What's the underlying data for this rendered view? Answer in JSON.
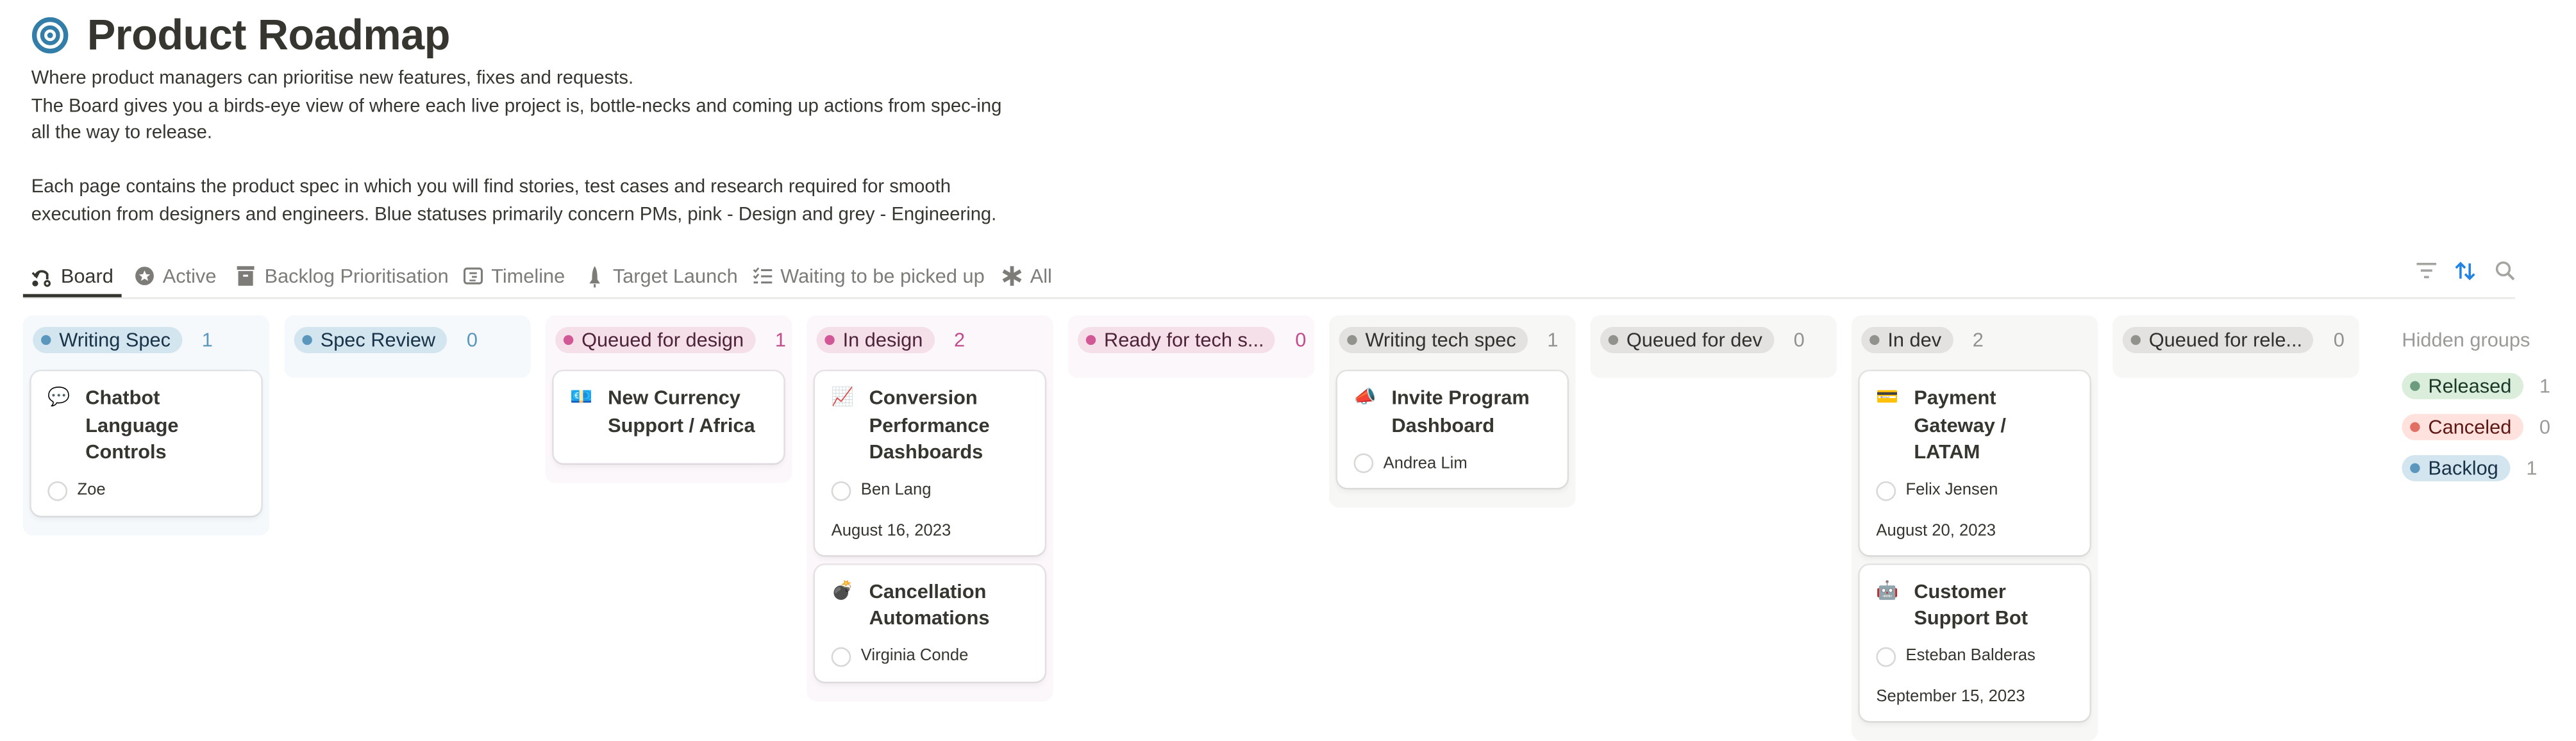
{
  "page": {
    "icon": "target-icon",
    "title": "Product Roadmap",
    "description": [
      "Where product managers can prioritise new features, fixes and requests.",
      "The Board gives you a birds-eye view of where each live project is, bottle-necks and coming up actions from spec-ing",
      "all the way to release.",
      "",
      "Each page contains the product spec in which you will find stories, test cases and research required for smooth",
      "execution from designers and engineers. Blue statuses primarily concern PMs, pink - Design and grey - Engineering."
    ]
  },
  "tabs": [
    {
      "label": "Board",
      "icon": "board-icon",
      "active": true
    },
    {
      "label": "Active",
      "icon": "star-circle-icon",
      "active": false
    },
    {
      "label": "Backlog Prioritisation",
      "icon": "archive-box-icon",
      "active": false
    },
    {
      "label": "Timeline",
      "icon": "timeline-icon",
      "active": false
    },
    {
      "label": "Target Launch",
      "icon": "rocket-icon",
      "active": false
    },
    {
      "label": "Waiting to be picked up",
      "icon": "checklist-icon",
      "active": false
    },
    {
      "label": "All",
      "icon": "asterisk-icon",
      "active": false
    }
  ],
  "toolbar": {
    "filter_icon": "filter-icon",
    "sort_icon": "sort-icon",
    "search_icon": "search-icon"
  },
  "colors": {
    "blue_bg": "#f5f9fb",
    "blue_pill": "#d3e5ef",
    "blue_dot": "#5b97bd",
    "blue_text": "#183347",
    "blue_count": "#5b97bd",
    "pink_bg": "#fcf7fa",
    "pink_pill": "#f5e0e9",
    "pink_dot": "#d15796",
    "pink_text": "#4c2337",
    "pink_count": "#c14c8a",
    "grey_bg": "#f7f7f5",
    "grey_pill": "#e3e2e0",
    "grey_dot": "#91918e",
    "grey_text": "#32302c",
    "grey_count": "#91918e",
    "green_pill": "#dbeddb",
    "green_dot": "#6c9b7d",
    "green_text": "#1c3829",
    "red_pill": "#ffe2dd",
    "red_dot": "#e16f64",
    "red_text": "#5d1715",
    "accent": "#2383e2"
  },
  "columns": [
    {
      "label": "Writing Spec",
      "count": "1",
      "theme": "blue",
      "cards": [
        {
          "emoji": "💬",
          "title": "Chatbot Language Controls",
          "person": "Zoe",
          "date": null
        }
      ]
    },
    {
      "label": "Spec Review",
      "count": "0",
      "theme": "blue",
      "cards": []
    },
    {
      "label": "Queued for design",
      "count": "1",
      "theme": "pink",
      "cards": [
        {
          "emoji": "💶",
          "title": "New Currency Support / Africa",
          "person": null,
          "date": null
        }
      ]
    },
    {
      "label": "In design",
      "count": "2",
      "theme": "pink",
      "cards": [
        {
          "emoji": "📈",
          "title": "Conversion Performance Dashboards",
          "person": "Ben Lang",
          "date": "August 16, 2023"
        },
        {
          "emoji": "💣",
          "title": "Cancellation Automations",
          "person": "Virginia Conde",
          "date": null
        }
      ]
    },
    {
      "label": "Ready for tech s...",
      "count": "0",
      "theme": "pink",
      "cards": []
    },
    {
      "label": "Writing tech spec",
      "count": "1",
      "theme": "grey",
      "cards": [
        {
          "emoji": "📣",
          "title": "Invite Program Dashboard",
          "person": "Andrea Lim",
          "date": null
        }
      ]
    },
    {
      "label": "Queued for dev",
      "count": "0",
      "theme": "grey",
      "cards": []
    },
    {
      "label": "In dev",
      "count": "2",
      "theme": "grey",
      "cards": [
        {
          "emoji": "💳",
          "title": "Payment Gateway / LATAM",
          "person": "Felix Jensen",
          "date": "August 20, 2023"
        },
        {
          "emoji": "🤖",
          "title": "Customer Support Bot",
          "person": "Esteban Balderas",
          "date": "September 15, 2023"
        }
      ]
    },
    {
      "label": "Queued for rele...",
      "count": "0",
      "theme": "grey",
      "cards": []
    }
  ],
  "hidden_groups": {
    "label": "Hidden groups",
    "groups": [
      {
        "label": "Released",
        "count": "1",
        "theme": "green"
      },
      {
        "label": "Canceled",
        "count": "0",
        "theme": "red"
      },
      {
        "label": "Backlog",
        "count": "1",
        "theme": "blue"
      }
    ]
  }
}
